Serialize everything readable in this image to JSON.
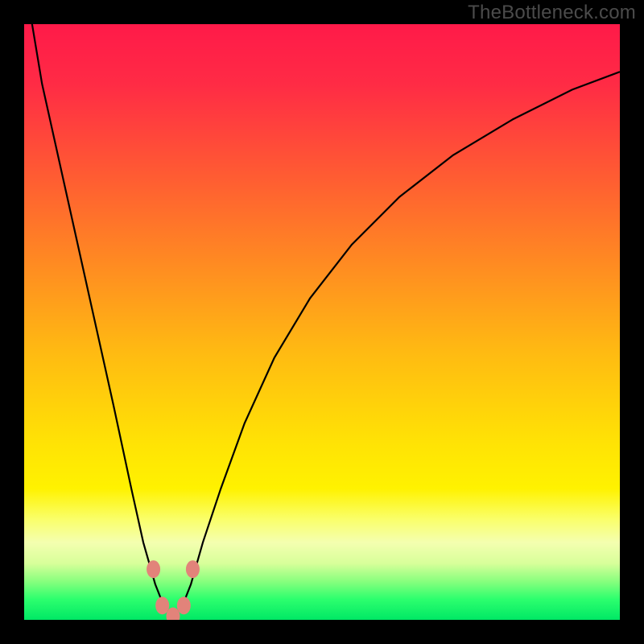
{
  "watermark": {
    "text": "TheBottleneck.com"
  },
  "colors": {
    "gradient_stops": [
      {
        "offset": 0.0,
        "color": "#ff1a49"
      },
      {
        "offset": 0.1,
        "color": "#ff2b45"
      },
      {
        "offset": 0.25,
        "color": "#ff5a33"
      },
      {
        "offset": 0.4,
        "color": "#ff8a22"
      },
      {
        "offset": 0.55,
        "color": "#ffba12"
      },
      {
        "offset": 0.7,
        "color": "#ffe205"
      },
      {
        "offset": 0.78,
        "color": "#fff200"
      },
      {
        "offset": 0.83,
        "color": "#faff68"
      },
      {
        "offset": 0.87,
        "color": "#f4ffb0"
      },
      {
        "offset": 0.905,
        "color": "#d8ff9a"
      },
      {
        "offset": 0.935,
        "color": "#89ff7e"
      },
      {
        "offset": 0.965,
        "color": "#2dff6e"
      },
      {
        "offset": 1.0,
        "color": "#00e865"
      }
    ],
    "curve": "#000000",
    "marker": "#e2837a"
  },
  "chart_data": {
    "type": "line",
    "title": "",
    "xlabel": "",
    "ylabel": "",
    "xlim": [
      0,
      100
    ],
    "ylim": [
      0,
      100
    ],
    "series": [
      {
        "name": "bottleneck-curve",
        "x": [
          0,
          3,
          7,
          11,
          15,
          18,
          20,
          22,
          23.5,
          25,
          26.5,
          28,
          30,
          33,
          37,
          42,
          48,
          55,
          63,
          72,
          82,
          92,
          100
        ],
        "y": [
          108,
          90,
          72,
          54,
          36,
          22,
          13,
          6,
          2.2,
          0.6,
          2.2,
          6,
          13,
          22,
          33,
          44,
          54,
          63,
          71,
          78,
          84,
          89,
          92
        ]
      }
    ],
    "markers": {
      "name": "highlight-dots",
      "x": [
        21.7,
        23.2,
        25.0,
        26.8,
        28.3
      ],
      "y": [
        8.5,
        2.4,
        0.6,
        2.4,
        8.5
      ]
    }
  }
}
